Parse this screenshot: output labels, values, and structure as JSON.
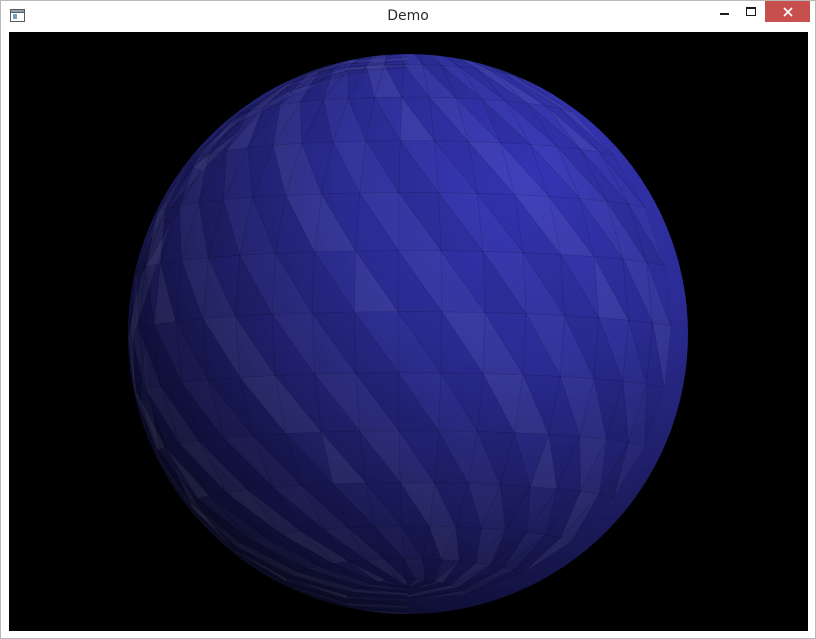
{
  "window": {
    "title": "Demo"
  },
  "icons": {
    "app": "app-window-icon",
    "minimize": "minimize-icon",
    "maximize": "maximize-icon",
    "close": "close-icon"
  },
  "scene": {
    "background": "#000000",
    "object": "faceted-sphere",
    "base_color": "#3535b8",
    "shadow_color": "#0a0a12"
  },
  "colors": {
    "close_button": "#c7504f",
    "title_text": "#2b2b2b"
  }
}
